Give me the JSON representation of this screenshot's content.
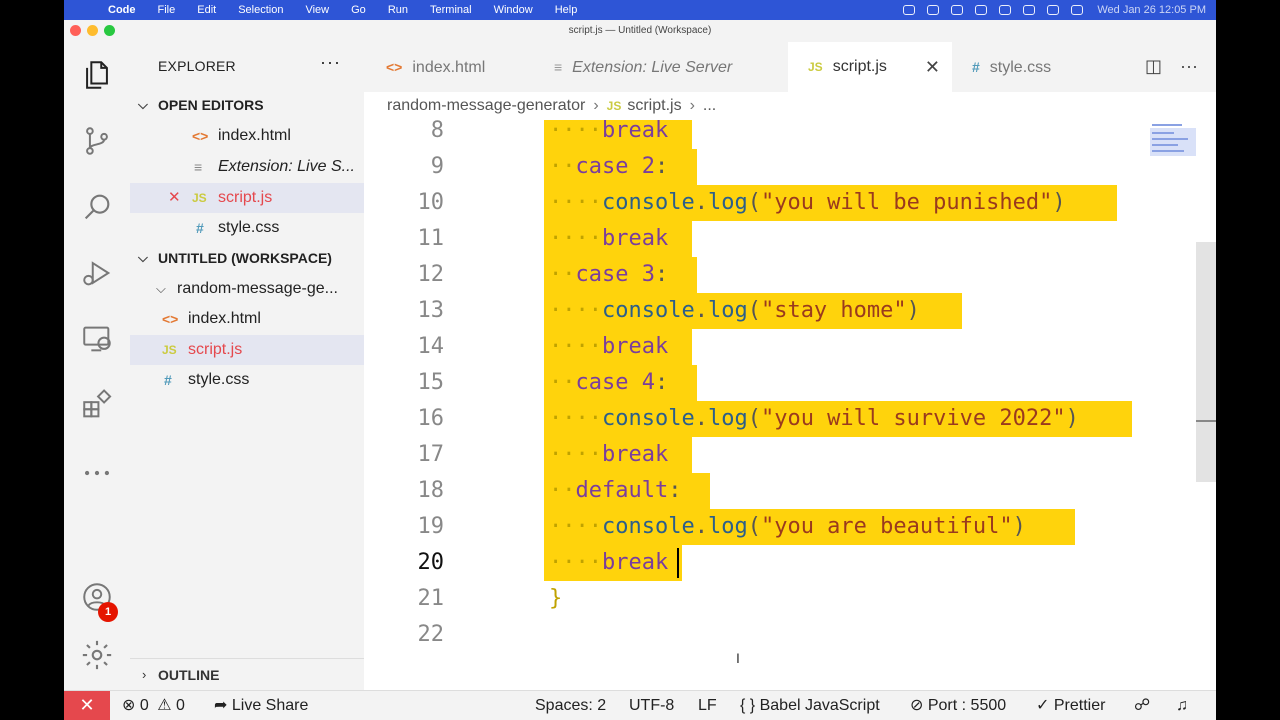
{
  "menubar": {
    "apple": "",
    "app": "Code",
    "menus": [
      "File",
      "Edit",
      "Selection",
      "View",
      "Go",
      "Run",
      "Terminal",
      "Window",
      "Help"
    ],
    "clock": "Wed Jan 26  12:05 PM"
  },
  "window": {
    "title": "script.js — Untitled (Workspace)"
  },
  "sidebar": {
    "title": "EXPLORER",
    "more": "···",
    "open_editors_label": "OPEN EDITORS",
    "open_editors": [
      {
        "icon": "<>",
        "label": "index.html"
      },
      {
        "icon": "≡",
        "label": "Extension: Live S..."
      },
      {
        "icon": "JS",
        "label": "script.js"
      },
      {
        "icon": "#",
        "label": "style.css"
      }
    ],
    "close_mark": "✕",
    "workspace_label": "UNTITLED (WORKSPACE)",
    "folder": "random-message-ge...",
    "files": [
      {
        "icon": "<>",
        "label": "index.html"
      },
      {
        "icon": "JS",
        "label": "script.js"
      },
      {
        "icon": "#",
        "label": "style.css"
      }
    ],
    "outline_label": "OUTLINE"
  },
  "activity": {
    "accounts_badge": "1"
  },
  "tabs": [
    {
      "icon": "<>",
      "label": "index.html"
    },
    {
      "icon": "≡",
      "label": "Extension: Live Server"
    },
    {
      "icon": "JS",
      "label": "script.js",
      "close": "✕"
    },
    {
      "icon": "#",
      "label": "style.css"
    }
  ],
  "tab_actions": {
    "split": "◫",
    "more": "···"
  },
  "breadcrumb": {
    "folder": "random-message-generator",
    "file_icon": "JS",
    "file": "script.js",
    "tail": "..."
  },
  "editor": {
    "current_line": 20,
    "lines": [
      {
        "num": "8",
        "indent": "····",
        "parts": [
          [
            "kw",
            "break"
          ]
        ]
      },
      {
        "num": "9",
        "indent": "··",
        "parts": [
          [
            "kw",
            "case "
          ],
          [
            "num",
            "2"
          ],
          [
            "pun",
            ":"
          ]
        ]
      },
      {
        "num": "10",
        "indent": "····",
        "parts": [
          [
            "fn",
            "console"
          ],
          [
            "pun",
            "."
          ],
          [
            "fn",
            "log"
          ],
          [
            "pun",
            "("
          ],
          [
            "str",
            "\"you will be punished\""
          ],
          [
            "pun",
            ")"
          ]
        ]
      },
      {
        "num": "11",
        "indent": "····",
        "parts": [
          [
            "kw",
            "break"
          ]
        ]
      },
      {
        "num": "12",
        "indent": "··",
        "parts": [
          [
            "kw",
            "case "
          ],
          [
            "num",
            "3"
          ],
          [
            "pun",
            ":"
          ]
        ]
      },
      {
        "num": "13",
        "indent": "····",
        "parts": [
          [
            "fn",
            "console"
          ],
          [
            "pun",
            "."
          ],
          [
            "fn",
            "log"
          ],
          [
            "pun",
            "("
          ],
          [
            "str",
            "\"stay home\""
          ],
          [
            "pun",
            ")"
          ]
        ]
      },
      {
        "num": "14",
        "indent": "····",
        "parts": [
          [
            "kw",
            "break"
          ]
        ]
      },
      {
        "num": "15",
        "indent": "··",
        "parts": [
          [
            "kw",
            "case "
          ],
          [
            "num",
            "4"
          ],
          [
            "pun",
            ":"
          ]
        ]
      },
      {
        "num": "16",
        "indent": "····",
        "parts": [
          [
            "fn",
            "console"
          ],
          [
            "pun",
            "."
          ],
          [
            "fn",
            "log"
          ],
          [
            "pun",
            "("
          ],
          [
            "str",
            "\"you will survive 2022\""
          ],
          [
            "pun",
            ")"
          ]
        ]
      },
      {
        "num": "17",
        "indent": "····",
        "parts": [
          [
            "kw",
            "break"
          ]
        ]
      },
      {
        "num": "18",
        "indent": "··",
        "parts": [
          [
            "kw",
            "default"
          ],
          [
            "pun",
            ":"
          ]
        ]
      },
      {
        "num": "19",
        "indent": "····",
        "parts": [
          [
            "fn",
            "console"
          ],
          [
            "pun",
            "."
          ],
          [
            "fn",
            "log"
          ],
          [
            "pun",
            "("
          ],
          [
            "str",
            "\"you are beautiful\""
          ],
          [
            "pun",
            ")"
          ]
        ]
      },
      {
        "num": "20",
        "indent": "····",
        "parts": [
          [
            "kw",
            "break"
          ]
        ]
      },
      {
        "num": "21",
        "indent": "",
        "parts": [
          [
            "ws",
            "}"
          ]
        ]
      },
      {
        "num": "22",
        "indent": "",
        "parts": []
      }
    ]
  },
  "status": {
    "remote": "✕",
    "errors": "0",
    "warnings": "0",
    "live_share": "Live Share",
    "spaces": "Spaces: 2",
    "encoding": "UTF-8",
    "eol": "LF",
    "language": "Babel JavaScript",
    "port": "Port : 5500",
    "prettier": "Prettier"
  },
  "colors": {
    "selection": "#ffd30c",
    "menubar": "#2e55d6",
    "remote": "#e5484d"
  }
}
